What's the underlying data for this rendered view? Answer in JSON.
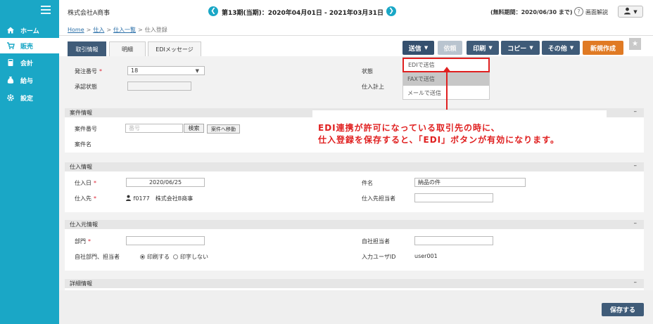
{
  "sidebar": {
    "items": [
      {
        "label": "ホーム",
        "icon": "home-icon"
      },
      {
        "label": "販売",
        "icon": "cart-icon"
      },
      {
        "label": "会計",
        "icon": "calculator-icon"
      },
      {
        "label": "給与",
        "icon": "money-bag-icon"
      },
      {
        "label": "設定",
        "icon": "gear-icon"
      }
    ]
  },
  "header": {
    "company": "株式会社A商事",
    "period": "第13期(当期)：2020年04月01日 - 2021年03月31日",
    "trial": "(無料期間：2020/06/30 まで)",
    "help": "画面解説",
    "help_icon": "?"
  },
  "breadcrumb": [
    "Home",
    "仕入",
    "仕入一覧",
    "仕入登録"
  ],
  "tabs": [
    "取引情報",
    "明細",
    "EDIメッセージ"
  ],
  "toolbar": {
    "send": "送信",
    "request": "依頼",
    "print": "印刷",
    "copy": "コピー",
    "other": "その他",
    "new": "新規作成"
  },
  "send_menu": [
    "EDIで送信",
    "FAXで送信",
    "メールで送信"
  ],
  "order": {
    "number_label": "発注番号",
    "number_value": "18",
    "approval_label": "承認状態",
    "status_label": "状態",
    "stock_label": "仕入計上"
  },
  "case": {
    "title": "案件情報",
    "number_label": "案件番号",
    "number_placeholder": "番号",
    "search_btn": "検索",
    "move_btn": "案件へ移動",
    "name_label": "案件名"
  },
  "purchase": {
    "title": "仕入情報",
    "date_label": "仕入日",
    "date_value": "2020/06/25",
    "supplier_label": "仕入先",
    "supplier_value": "f0177　株式会社B商事",
    "subject_label": "件名",
    "subject_value": "納品の件",
    "contact_label": "仕入先担当者"
  },
  "origin": {
    "title": "仕入元情報",
    "dept_label": "部門",
    "own_contact_label": "自社担当者",
    "print_label": "自社部門、担当者",
    "print_on": "印刷する",
    "print_off": "印字しない",
    "input_user_label": "入力ユーザID",
    "input_user_value": "user001"
  },
  "detail": {
    "title": "詳細情報"
  },
  "callout": {
    "line1": "EDI連携が許可になっている取引先の時に、",
    "line2": "仕入登録を保存すると、「EDI」ボタンが有効になります。"
  },
  "footer": {
    "save": "保存する"
  },
  "colors": {
    "sidebar": "#1aa7c6",
    "nav_button": "#3f5b78",
    "accent_orange": "#e07a24",
    "annotation_red": "#e02020"
  }
}
